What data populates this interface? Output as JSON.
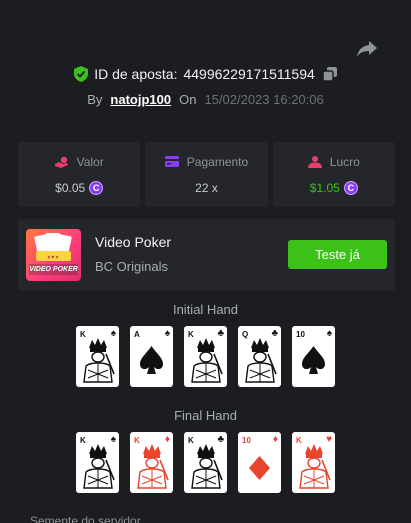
{
  "header": {
    "bet_id_label": "ID de aposta:",
    "bet_id": "44996229171511594",
    "by_label": "By",
    "username": "natojp100",
    "on_label": "On",
    "datetime": "15/02/2023 16:20:06"
  },
  "stats": [
    {
      "label": "Valor",
      "value": "$0.05",
      "has_coin": true,
      "value_color": "#c8cbd0"
    },
    {
      "label": "Pagamento",
      "value": "22 x",
      "has_coin": false,
      "value_color": "#c8cbd0"
    },
    {
      "label": "Lucro",
      "value": "$1.05",
      "has_coin": true,
      "value_color": "#3bc117"
    }
  ],
  "game": {
    "name": "Video Poker",
    "provider": "BC Originals",
    "thumb_text": "VIDEO POKER",
    "try_button": "Teste já"
  },
  "initial_hand": {
    "title": "Initial Hand",
    "cards": [
      {
        "rank": "K",
        "suit": "♠",
        "color": "black",
        "face": true
      },
      {
        "rank": "A",
        "suit": "♠",
        "color": "black",
        "face": false
      },
      {
        "rank": "K",
        "suit": "♣",
        "color": "black",
        "face": true
      },
      {
        "rank": "Q",
        "suit": "♣",
        "color": "black",
        "face": true
      },
      {
        "rank": "10",
        "suit": "♠",
        "color": "black",
        "face": false
      }
    ]
  },
  "final_hand": {
    "title": "Final Hand",
    "cards": [
      {
        "rank": "K",
        "suit": "♠",
        "color": "black",
        "face": true
      },
      {
        "rank": "K",
        "suit": "♦",
        "color": "red",
        "face": true
      },
      {
        "rank": "K",
        "suit": "♣",
        "color": "black",
        "face": true
      },
      {
        "rank": "10",
        "suit": "♦",
        "color": "red",
        "face": false
      },
      {
        "rank": "K",
        "suit": "♥",
        "color": "red",
        "face": true
      }
    ]
  },
  "footer": {
    "seed_label": "Semente do servidor"
  },
  "colors": {
    "background": "#1b1d21",
    "panel": "#24262b",
    "accent_green": "#3bc117",
    "coin_purple": "#8b3df5"
  },
  "icons": {
    "share": "share-icon",
    "shield": "shield-check-icon",
    "copy": "copy-icon",
    "valor": "hand-coin-icon",
    "pagamento": "credit-card-icon",
    "lucro": "profit-user-icon"
  }
}
